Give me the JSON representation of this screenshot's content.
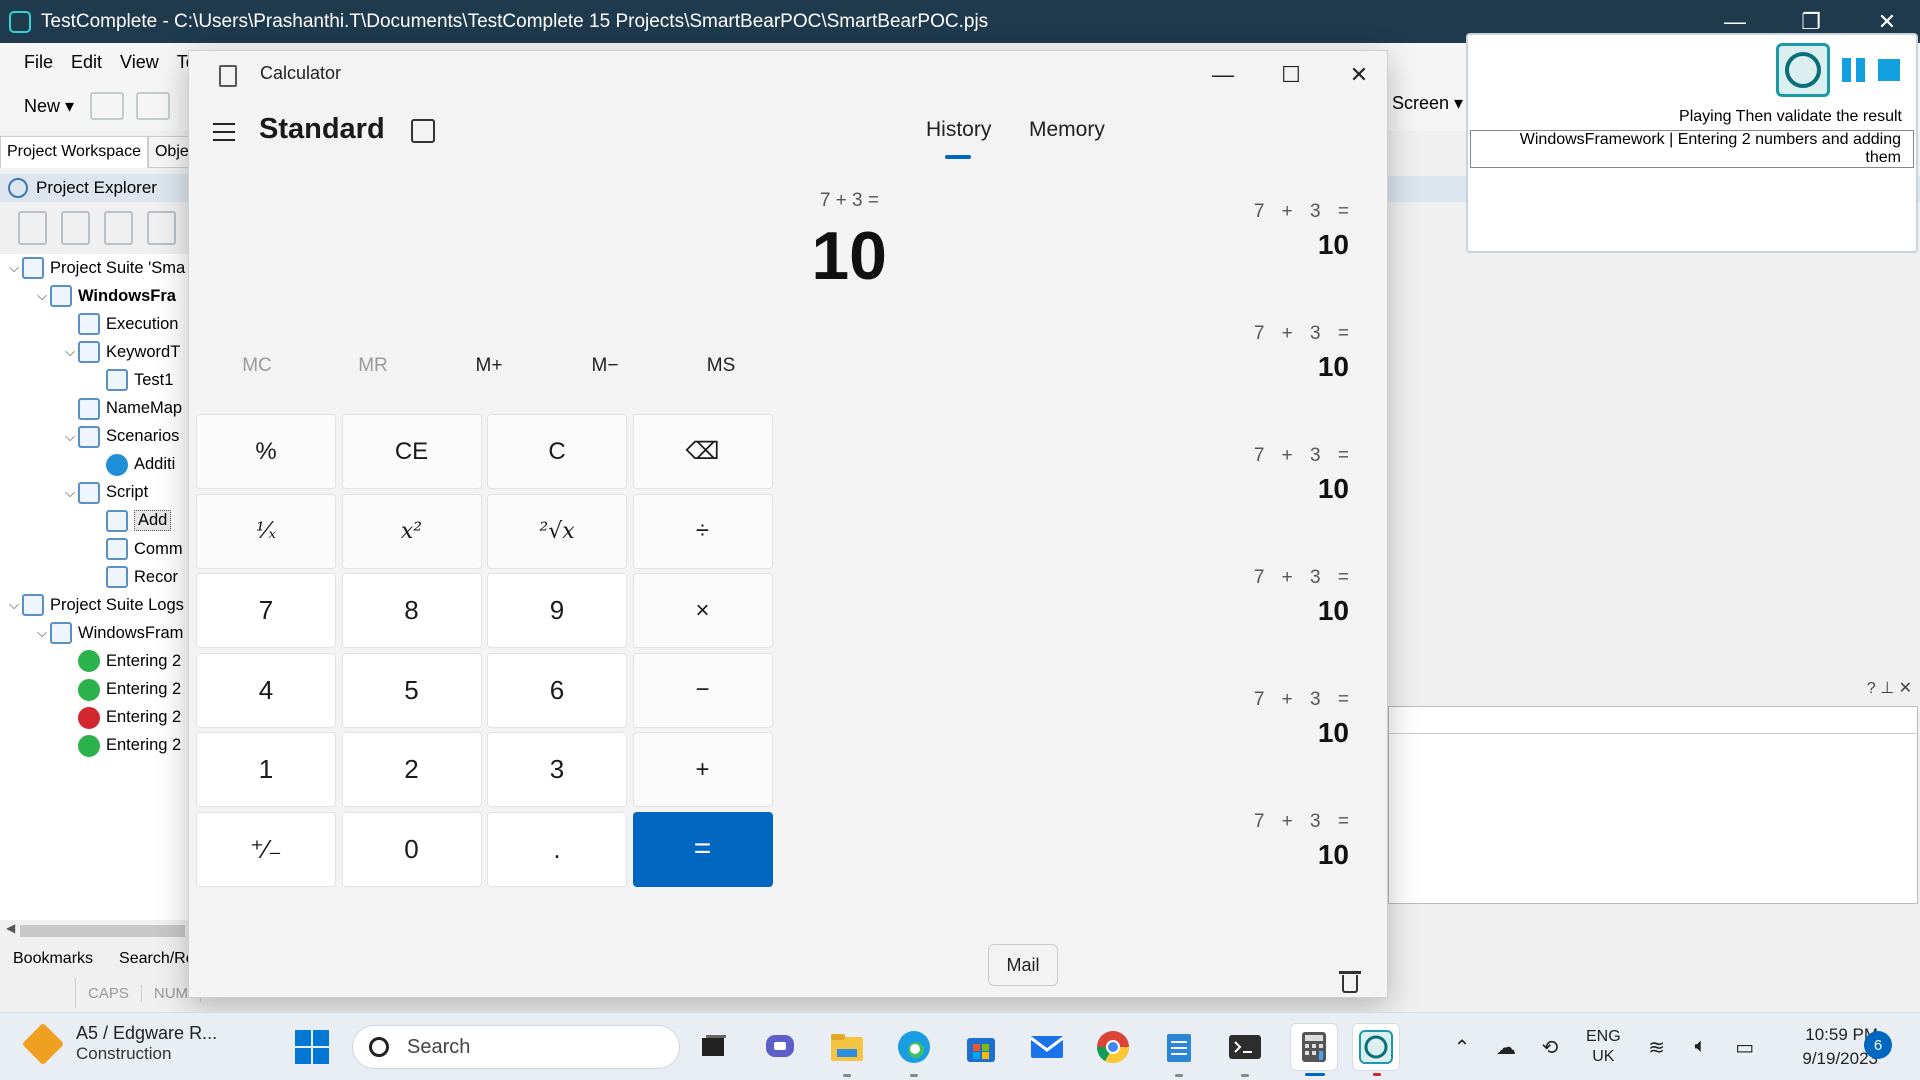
{
  "testcomplete": {
    "title": "TestComplete - C:\\Users\\Prashanthi.T\\Documents\\TestComplete 15 Projects\\SmartBearPOC\\SmartBearPOC.pjs",
    "menu": [
      "File",
      "Edit",
      "View",
      "Te"
    ],
    "toolbar_new": "New",
    "toolbar_screen": "Screen",
    "tabs": [
      "Project Workspace",
      "Obje"
    ],
    "explorer_title": "Project Explorer",
    "tree": [
      {
        "label": "Project Suite 'Sma",
        "level": 0,
        "expanded": true,
        "icon": "suite-icon"
      },
      {
        "label": "WindowsFra",
        "level": 1,
        "expanded": true,
        "bold": true,
        "icon": "project-icon"
      },
      {
        "label": "Execution",
        "level": 2,
        "icon": "execution-plan-icon"
      },
      {
        "label": "KeywordT",
        "level": 2,
        "expanded": true,
        "icon": "folder-icon"
      },
      {
        "label": "Test1",
        "level": 3,
        "icon": "keyword-test-icon"
      },
      {
        "label": "NameMap",
        "level": 2,
        "icon": "namemapping-icon"
      },
      {
        "label": "Scenarios",
        "level": 2,
        "expanded": true,
        "icon": "folder-icon"
      },
      {
        "label": "Additi",
        "level": 3,
        "icon": "scenario-icon"
      },
      {
        "label": "Script",
        "level": 2,
        "expanded": true,
        "icon": "folder-icon"
      },
      {
        "label": "Add",
        "level": 3,
        "selected": true,
        "icon": "script-unit-icon"
      },
      {
        "label": "Comm",
        "level": 3,
        "icon": "script-unit-icon"
      },
      {
        "label": "Recor",
        "level": 3,
        "icon": "script-unit-icon"
      },
      {
        "label": "Project Suite Logs",
        "level": 0,
        "expanded": true,
        "icon": "logs-icon"
      },
      {
        "label": "WindowsFram",
        "level": 1,
        "expanded": true,
        "icon": "log-folder-icon"
      },
      {
        "label": "Entering 2",
        "level": 2,
        "status": "ok",
        "icon": "log-pass-icon"
      },
      {
        "label": "Entering 2",
        "level": 2,
        "status": "ok",
        "icon": "log-pass-icon"
      },
      {
        "label": "Entering 2",
        "level": 2,
        "status": "err",
        "icon": "log-fail-icon"
      },
      {
        "label": "Entering 2",
        "level": 2,
        "status": "ok",
        "icon": "log-pass-icon"
      }
    ],
    "bottom_tabs": [
      "Bookmarks",
      "Search/Re"
    ],
    "status": [
      "CAPS",
      "NUM"
    ],
    "play_panel": {
      "message1": "Playing Then validate the result",
      "message2": "WindowsFramework | Entering 2 numbers and adding them"
    }
  },
  "calculator": {
    "window_title": "Calculator",
    "mode": "Standard",
    "tabs": [
      "History",
      "Memory"
    ],
    "active_tab": "History",
    "expression": "7 + 3 =",
    "result": "10",
    "memory_buttons": [
      {
        "label": "MC",
        "enabled": false
      },
      {
        "label": "MR",
        "enabled": false
      },
      {
        "label": "M+",
        "enabled": true
      },
      {
        "label": "M−",
        "enabled": true
      },
      {
        "label": "MS",
        "enabled": true
      }
    ],
    "keys": [
      [
        "%",
        "CE",
        "C",
        "⌫"
      ],
      [
        "¹⁄ₓ",
        "x²",
        "²√x",
        "÷"
      ],
      [
        "7",
        "8",
        "9",
        "×"
      ],
      [
        "4",
        "5",
        "6",
        "−"
      ],
      [
        "1",
        "2",
        "3",
        "+"
      ],
      [
        "⁺⁄₋",
        "0",
        ".",
        "="
      ]
    ],
    "history": [
      {
        "expression": "7  +  3 =",
        "result": "10"
      },
      {
        "expression": "7  +  3 =",
        "result": "10"
      },
      {
        "expression": "7  +  3 =",
        "result": "10"
      },
      {
        "expression": "7  +  3 =",
        "result": "10"
      },
      {
        "expression": "7  +  3 =",
        "result": "10"
      },
      {
        "expression": "7  +  3 =",
        "result": "10"
      }
    ],
    "tooltip": "Mail"
  },
  "taskbar": {
    "weather_line1": "A5 / Edgware R...",
    "weather_line2": "Construction",
    "search_placeholder": "Search",
    "lang_line1": "ENG",
    "lang_line2": "UK",
    "time": "10:59 PM",
    "date": "9/19/2023",
    "notifications": "6",
    "accent": "#0067c0"
  }
}
